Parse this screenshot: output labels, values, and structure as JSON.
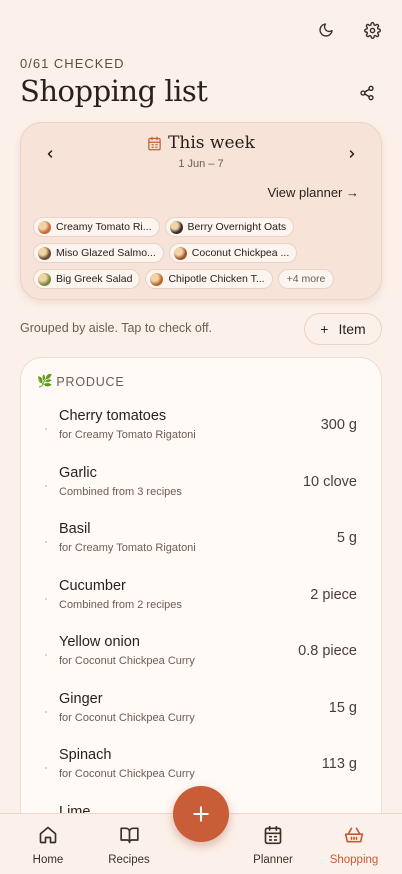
{
  "header": {
    "checked_text": "0/61 CHECKED",
    "title": "Shopping list"
  },
  "week": {
    "title": "This week",
    "range": "1 Jun – 7",
    "view_planner": "View planner →"
  },
  "recipes": [
    {
      "label": "Creamy Tomato Ri...",
      "color": "#c9683a"
    },
    {
      "label": "Berry Overnight Oats",
      "color": "#3b2a2a"
    },
    {
      "label": "Miso Glazed Salmo...",
      "color": "#6e4a33"
    },
    {
      "label": "Coconut Chickpea ...",
      "color": "#a0552e"
    },
    {
      "label": "Big Greek Salad",
      "color": "#7a8a3a"
    },
    {
      "label": "Chipotle Chicken T...",
      "color": "#b86a2c"
    }
  ],
  "more_label": "+4 more",
  "hint": "Grouped by aisle. Tap to check off.",
  "add_item": {
    "icon": "+",
    "label": "Item"
  },
  "section": {
    "emoji": "🌿",
    "title": "PRODUCE"
  },
  "items": [
    {
      "name": "Cherry tomatoes",
      "sub": "for Creamy Tomato Rigatoni",
      "qty": "300 g"
    },
    {
      "name": "Garlic",
      "sub": "Combined from 3 recipes",
      "qty": "10 clove"
    },
    {
      "name": "Basil",
      "sub": "for Creamy Tomato Rigatoni",
      "qty": "5 g"
    },
    {
      "name": "Cucumber",
      "sub": "Combined from 2 recipes",
      "qty": "2 piece"
    },
    {
      "name": "Yellow onion",
      "sub": "for Coconut Chickpea Curry",
      "qty": "0.8 piece"
    },
    {
      "name": "Ginger",
      "sub": "for Coconut Chickpea Curry",
      "qty": "15 g"
    },
    {
      "name": "Spinach",
      "sub": "for Coconut Chickpea Curry",
      "qty": "113 g"
    },
    {
      "name": "Lime",
      "sub": "",
      "qty": ""
    }
  ],
  "nav": {
    "home": "Home",
    "recipes": "Recipes",
    "planner": "Planner",
    "shopping": "Shopping"
  },
  "colors": {
    "accent": "#c85d37",
    "background": "#fcf1ea"
  }
}
